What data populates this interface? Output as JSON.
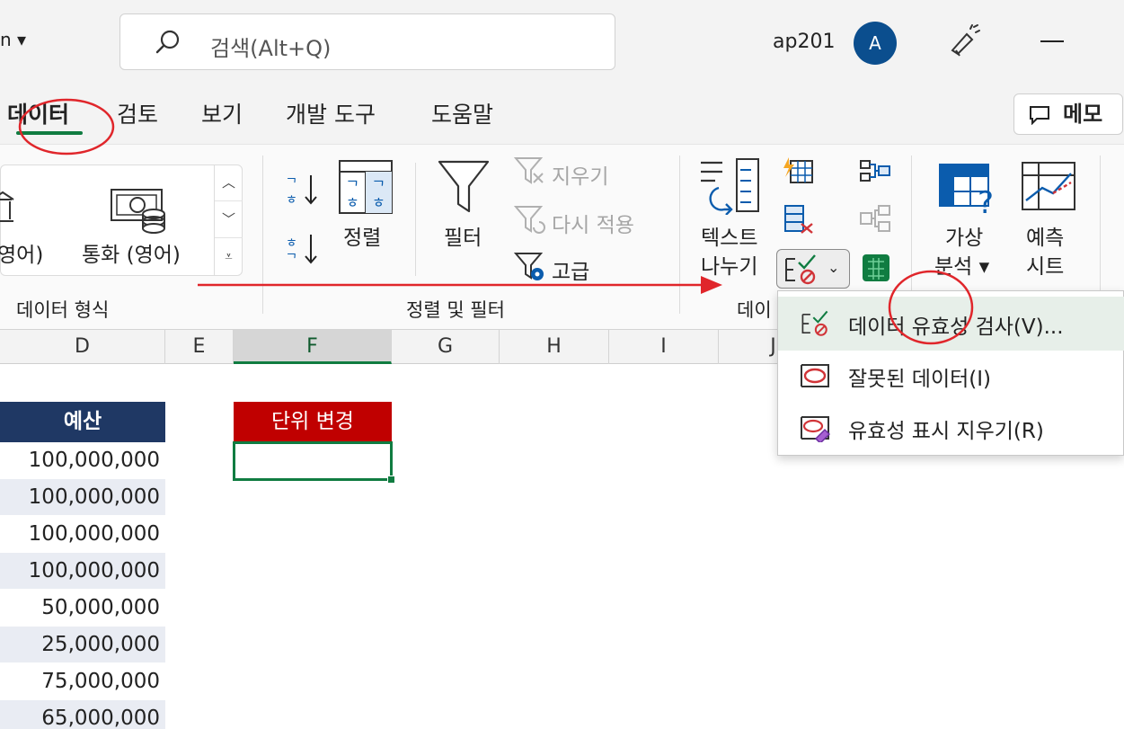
{
  "title_bar": {
    "account_fragment": "n ▾",
    "search_placeholder": "검색(Alt+Q)",
    "user_name": "ap201",
    "avatar_initial": "A"
  },
  "tabs": [
    {
      "label": "데이터",
      "active": true
    },
    {
      "label": "검토"
    },
    {
      "label": "보기"
    },
    {
      "label": "개발 도구"
    },
    {
      "label": "도움말"
    }
  ],
  "memo_button": "메모",
  "ribbon": {
    "data_types": {
      "item_partial": "영어)",
      "item_currency": "통화 (영어)",
      "group_label": "데이터 형식"
    },
    "sort_filter": {
      "sort_label": "정렬",
      "filter_label": "필터",
      "clear_label": "지우기",
      "reapply_label": "다시 적용",
      "advanced_label": "고급",
      "group_label": "정렬 및 필터"
    },
    "data_tools": {
      "text_to_columns_line1": "텍스트",
      "text_to_columns_line2": "나누기",
      "group_label_partial": "데이"
    },
    "forecast": {
      "whatif_line1": "가상",
      "whatif_line2": "분석 ▾",
      "sheet_line1": "예측",
      "sheet_line2": "시트"
    }
  },
  "columns": [
    "D",
    "E",
    "F",
    "G",
    "H",
    "I",
    "J"
  ],
  "sheet": {
    "budget_header": "예산",
    "budget_values": [
      "100,000,000",
      "100,000,000",
      "100,000,000",
      "100,000,000",
      "50,000,000",
      "25,000,000",
      "75,000,000",
      "65,000,000"
    ],
    "unit_change_header": "단위 변경"
  },
  "dropdown_menu": [
    {
      "label": "데이터 유효성 검사(V)..."
    },
    {
      "label": "잘못된 데이터(I)"
    },
    {
      "label": "유효성 표시 지우기(R)"
    }
  ],
  "colors": {
    "accent_green": "#107c41",
    "budget_header_bg": "#1f3864",
    "unit_header_bg": "#c00000",
    "annotation_red": "#e0262b"
  }
}
